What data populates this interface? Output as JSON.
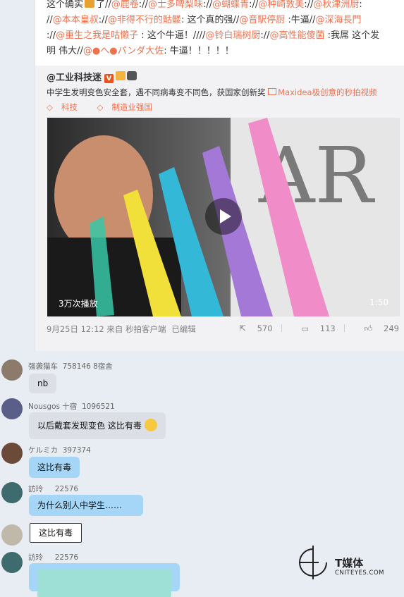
{
  "post": {
    "comment_prefix": "这个确实",
    "comment_mid": "了//",
    "mentions_line1": [
      "@鹿卷",
      "@士多啤梨味",
      "@蝴蝶青",
      "@种崎敦美",
      "@秋津洲厨"
    ],
    "mentions_line2": [
      "@本本皇叔",
      "@非得不行的骷髅"
    ],
    "line2_text": "这个真的强//",
    "line2_mentions_b": [
      "@音駅停厨",
      "@深海長門"
    ],
    "line2_text_b": "牛逼//",
    "line3_a": "@重生之我是咕懒子",
    "line3_text_a": "这个牛逼！//",
    "line3_b": "@铃白瑞树厨",
    "line3_c": "@高性能傻菌",
    "line3_text_c": "我屌 这个发",
    "line4_text": "明 伟大//",
    "line4_mention": "@●へ●パンダ大佐",
    "line4_text_b": "牛逼！！！！！"
  },
  "retweet": {
    "author": "@工业科技迷",
    "badge": "V",
    "description": "中学生发明变色安全套，遇不同病毒变不同色，获国家创新奖",
    "link": "Maxidea极创意的秒拍视频",
    "topics": [
      "科技",
      "制造业强国"
    ],
    "video_plays": "3万次播放",
    "video_duration": "1:50",
    "timestamp": "9月25日 12:12 来自 秒拍客户端",
    "edited": "已编辑",
    "repost_count": "570",
    "comment_count": "113",
    "like_count": "249"
  },
  "chat": [
    {
      "name": "强袭猫车",
      "meta": "758146 8宿舍",
      "message": "nb",
      "style": "grey"
    },
    {
      "name": "Nousgos 十宿",
      "meta": "1096521",
      "message": "以后戴套发现变色 这比有毒",
      "style": "grey"
    },
    {
      "name": "ケルミカ",
      "meta": "397374",
      "message": "这比有毒",
      "style": "blue"
    },
    {
      "name": "訪玲",
      "meta": "22576",
      "message": "为什么别人中学生……",
      "style": "blue"
    },
    {
      "name": "",
      "meta": "",
      "message": "这比有毒",
      "style": "white"
    },
    {
      "name": "訪玲",
      "meta": "22576",
      "message": "",
      "style": "blue"
    }
  ],
  "watermark": {
    "title": "T媒体",
    "subtitle": "CNITEYES.COM"
  },
  "colors": {
    "link": "#eb7350",
    "bubble_grey": "#dcdfe6",
    "bubble_blue": "#a5d6f7",
    "background": "#e8ecf3"
  }
}
